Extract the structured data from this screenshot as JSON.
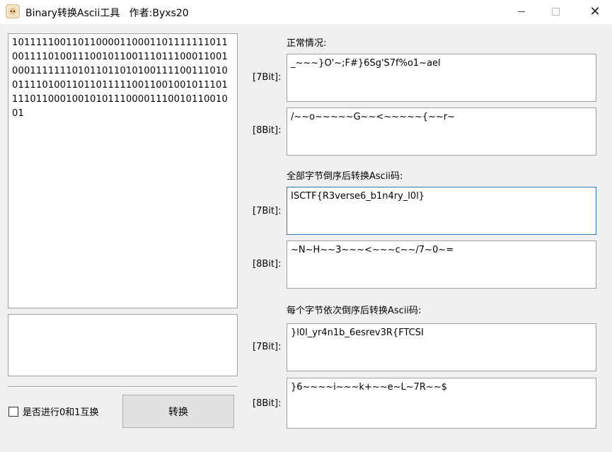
{
  "window": {
    "title": "Binary转换Ascii工具   作者:Byxs20",
    "minimize_icon": "minimize-icon",
    "maximize_icon": "maximize-icon",
    "close_glyph": "✕"
  },
  "left": {
    "binary_text": "101111100110110000110001101111111011001111010011100101100111011100011001000111111101011011010100111100111010011110100110110111110011001001011101111011000100101011100001110010110010 01",
    "bottom_text": "",
    "swap_label": "是否进行0和1互换",
    "convert_label": "转换"
  },
  "right": {
    "sections": [
      {
        "title": "正常情况:",
        "bit7_label": "[7Bit]:",
        "bit7_value": "_~~~}O'~;F#}6Sg'S7f%o1~ael",
        "bit8_label": "[8Bit]:",
        "bit8_value": "/~~o~~~~~G~~<~~~~~{~~r~"
      },
      {
        "title": "全部字节倒序后转换Ascii码:",
        "bit7_label": "[7Bit]:",
        "bit7_value": "ISCTF{R3verse6_b1n4ry_l0l}",
        "bit8_label": "[8Bit]:",
        "bit8_value": "~N~H~~3~~~<~~~c~~/7~0~="
      },
      {
        "title": "每个字节依次倒序后转换Ascii码:",
        "bit7_label": "[7Bit]:",
        "bit7_value": "}l0l_yr4n1b_6esrev3R{FTCSI",
        "bit8_label": "[8Bit]:",
        "bit8_value": "}6~~~~i~~~k+~~e~L~7R~~$"
      }
    ]
  }
}
